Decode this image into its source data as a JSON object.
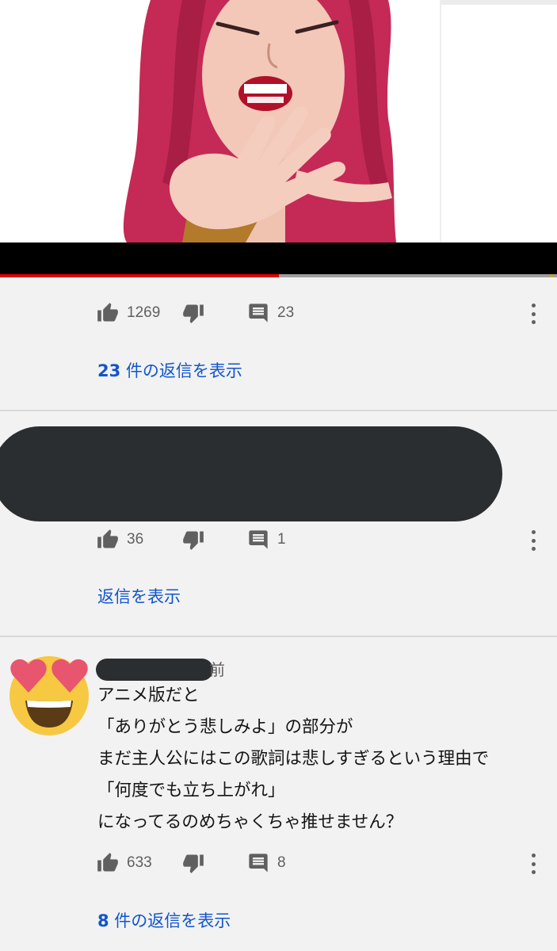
{
  "video": {
    "progress_fraction": 0.5
  },
  "comments": [
    {
      "likes": "1269",
      "reply_count": "23",
      "view_replies": "23 件の返信を表示",
      "view_replies_num": "23",
      "view_replies_rest": " 件の返信を表示"
    },
    {
      "likes": "36",
      "reply_count": "1",
      "view_replies": "返信を表示"
    },
    {
      "author_suffix": "前",
      "lines": [
        "アニメ版だと",
        "「ありがとう悲しみよ」の部分が",
        "まだ主人公にはこの歌詞は悲しすぎるという理由で",
        "「何度でも立ち上がれ」",
        "になってるのめちゃくちゃ推せません？"
      ],
      "likes": "633",
      "reply_count": "8",
      "view_replies_num": "8",
      "view_replies_rest": " 件の返信を表示"
    }
  ],
  "icons": {
    "like": "thumbs-up-icon",
    "dislike": "thumbs-down-icon",
    "reply": "comment-icon",
    "more": "more-vert-icon",
    "avatar": "heart-eyes-emoji-icon"
  },
  "colors": {
    "link": "#1155cc",
    "progress": "#e00000",
    "redaction": "#2b2e31"
  }
}
